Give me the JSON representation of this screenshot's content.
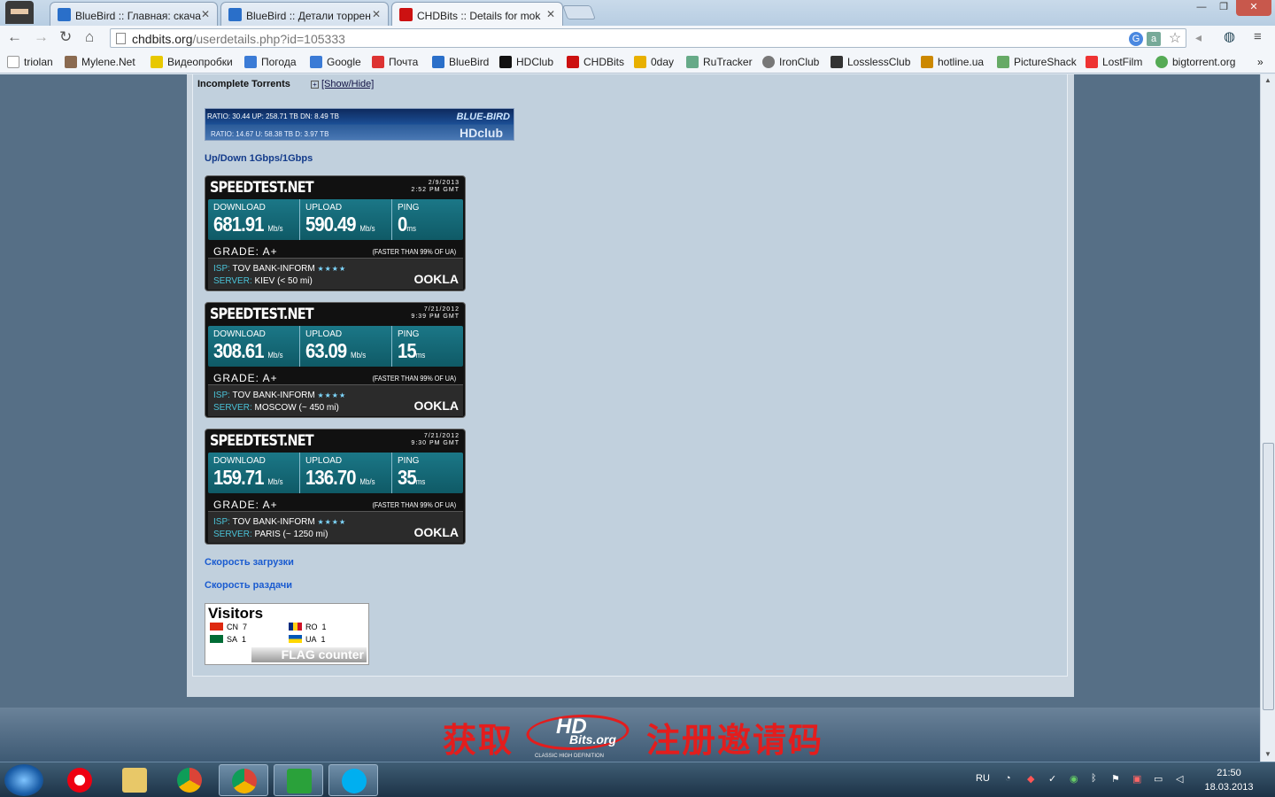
{
  "browser": {
    "tabs": [
      {
        "title": "BlueBird :: Главная: скача",
        "icon_color": "#2a6fc9"
      },
      {
        "title": "BlueBird :: Детали торрен",
        "icon_color": "#2a6fc9"
      },
      {
        "title": "CHDBits :: Details for mok",
        "icon_color": "#cc1111"
      }
    ],
    "window_buttons": {
      "minimize": "—",
      "maximize": "❐",
      "close": "✕"
    },
    "url_host": "chdbits.org",
    "url_path": "/userdetails.php?id=105333",
    "bookmarks": [
      {
        "label": "triolan",
        "color": "#ffffff"
      },
      {
        "label": "Mylene.Net",
        "color": "#8a6a50"
      },
      {
        "label": "Видеопробки",
        "color": "#e8c800"
      },
      {
        "label": "Погода",
        "color": "#3b7bd6"
      },
      {
        "label": "Google",
        "color": "#3b7bd6"
      },
      {
        "label": "Почта",
        "color": "#d33"
      },
      {
        "label": "BlueBird",
        "color": "#2a6fc9"
      },
      {
        "label": "HDClub",
        "color": "#111"
      },
      {
        "label": "CHDBits",
        "color": "#c11"
      },
      {
        "label": "0day",
        "color": "#e8b000"
      },
      {
        "label": "RuTracker",
        "color": "#6a8"
      },
      {
        "label": "IronClub",
        "color": "#777"
      },
      {
        "label": "LosslessClub",
        "color": "#333"
      },
      {
        "label": "hotline.ua",
        "color": "#c80"
      },
      {
        "label": "PictureShack",
        "color": "#6a6"
      },
      {
        "label": "LostFilm",
        "color": "#e33"
      },
      {
        "label": "bigtorrent.org",
        "color": "#5a5"
      }
    ],
    "more_bookmarks": "»"
  },
  "page": {
    "incomplete_torrents": "Incomplete Torrents",
    "show_hide": "[Show/Hide]",
    "ratio_bar": {
      "line1": "RATIO: 30.44      UP: 258.71 TB          DN: 8.49 TB",
      "line1_logo": "BLUE-BIRD",
      "line2": "RATIO: 14.67           U: 58.38 TB          D: 3.97 TB",
      "line2_logo": "HDclub"
    },
    "updown": "Up/Down 1Gbps/1Gbps",
    "speedtests": [
      {
        "date": "2/9/2013",
        "time": "2:52 PM GMT",
        "download": "681.91",
        "upload": "590.49",
        "ping": "0",
        "grade": "GRADE: A+",
        "faster": "(FASTER THAN 99% OF UA)",
        "isp": "TOV BANK-INFORM",
        "server": "KIEV (< 50 mi)"
      },
      {
        "date": "7/21/2012",
        "time": "9:39 PM GMT",
        "download": "308.61",
        "upload": "63.09",
        "ping": "15",
        "grade": "GRADE: A+",
        "faster": "(FASTER THAN 99% OF UA)",
        "isp": "TOV BANK-INFORM",
        "server": "MOSCOW (~ 450 mi)"
      },
      {
        "date": "7/21/2012",
        "time": "9:30 PM GMT",
        "download": "159.71",
        "upload": "136.70",
        "ping": "35",
        "grade": "GRADE: A+",
        "faster": "(FASTER THAN 99% OF UA)",
        "isp": "TOV BANK-INFORM",
        "server": "PARIS (~ 1250 mi)"
      }
    ],
    "speedtest_labels": {
      "brand": "SPEEDTEST.NET",
      "download": "DOWNLOAD",
      "upload": "UPLOAD",
      "ping": "PING",
      "mbps": "Mb/s",
      "ms": "ms",
      "isp_key": "ISP:",
      "server_key": "SERVER:",
      "stars": "★★★★",
      "ookla": "OOKLA"
    },
    "download_speed_link": "Скорость загрузки",
    "upload_speed_link": "Скорость раздачи",
    "visitors": {
      "title": "Visitors",
      "rows": [
        {
          "code": "CN",
          "count": "7",
          "color": "#de2910"
        },
        {
          "code": "RO",
          "count": "1",
          "color": "#fcd116"
        },
        {
          "code": "SA",
          "count": "1",
          "color": "#006c35"
        },
        {
          "code": "UA",
          "count": "1",
          "color": "#0057b7"
        }
      ],
      "brand": "FLAG counter"
    },
    "banner": {
      "left": "获取",
      "right": "注册邀请码",
      "logo": "HD",
      "logo_sub": "Bits.org",
      "tagline": "CLASSIC HIGH DEFINITION"
    }
  },
  "taskbar": {
    "lang": "RU",
    "time": "21:50",
    "date": "18.03.2013"
  }
}
